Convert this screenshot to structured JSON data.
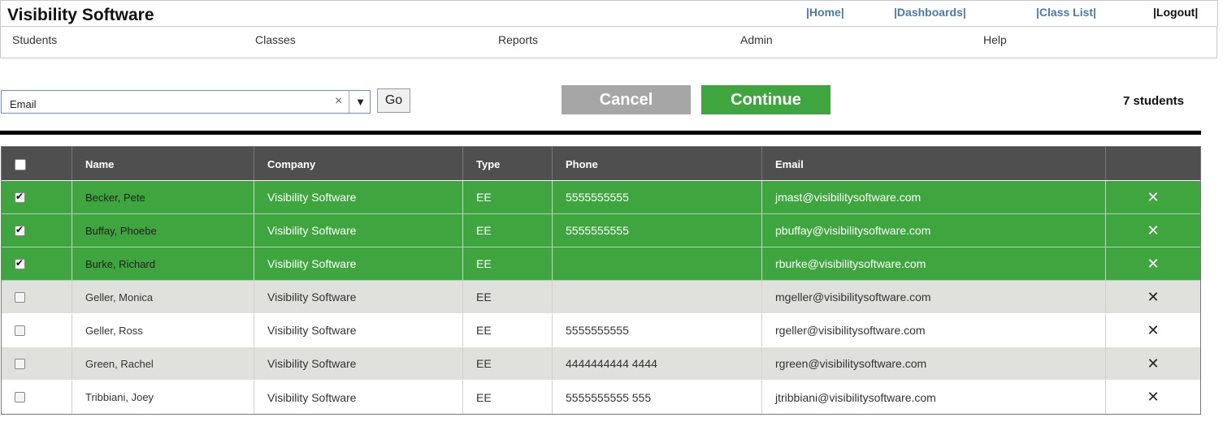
{
  "app": {
    "title": "Visibility Software"
  },
  "top_links": {
    "home": "|Home|",
    "dashboards": "|Dashboards|",
    "class_list": "|Class List|",
    "logout": "|Logout|"
  },
  "menu": [
    "Students",
    "Classes",
    "Reports",
    "Admin",
    "Help"
  ],
  "filter": {
    "value": "Email",
    "clear_icon": "close-icon",
    "dropdown_icon": "triangle-down-icon"
  },
  "buttons": {
    "go": "Go",
    "cancel": "Cancel",
    "continue": "Continue"
  },
  "student_count": "7 students",
  "colors": {
    "selected_row": "#3fa53f",
    "header": "#4f4f4f",
    "cancel": "#a6a6a6",
    "continue": "#3fa53f",
    "alt_row": "#e0e0dc"
  },
  "table": {
    "headers": [
      "Name",
      "Company",
      "Type",
      "Phone",
      "Email"
    ],
    "rows": [
      {
        "checked": true,
        "name": "Becker, Pete",
        "company": "Visibility Software",
        "type": "EE",
        "phone": "5555555555",
        "email": "jmast@visibilitysoftware.com",
        "remove": "✕"
      },
      {
        "checked": true,
        "name": "Buffay, Phoebe",
        "company": "Visibility Software",
        "type": "EE",
        "phone": "5555555555",
        "email": "pbuffay@visibilitysoftware.com",
        "remove": "✕"
      },
      {
        "checked": true,
        "name": "Burke, Richard",
        "company": "Visibility Software",
        "type": "EE",
        "phone": "",
        "email": "rburke@visibilitysoftware.com",
        "remove": "✕"
      },
      {
        "checked": false,
        "name": "Geller, Monica",
        "company": "Visibility Software",
        "type": "EE",
        "phone": "",
        "email": "mgeller@visibilitysoftware.com",
        "remove": "✕"
      },
      {
        "checked": false,
        "name": "Geller, Ross",
        "company": "Visibility Software",
        "type": "EE",
        "phone": "5555555555",
        "email": "rgeller@visibilitysoftware.com",
        "remove": "✕"
      },
      {
        "checked": false,
        "name": "Green, Rachel",
        "company": "Visibility Software",
        "type": "EE",
        "phone": "4444444444 4444",
        "email": "rgreen@visibilitysoftware.com",
        "remove": "✕"
      },
      {
        "checked": false,
        "name": "Tribbiani, Joey",
        "company": "Visibility Software",
        "type": "EE",
        "phone": "5555555555 555",
        "email": "jtribbiani@visibilitysoftware.com",
        "remove": "✕"
      }
    ]
  }
}
